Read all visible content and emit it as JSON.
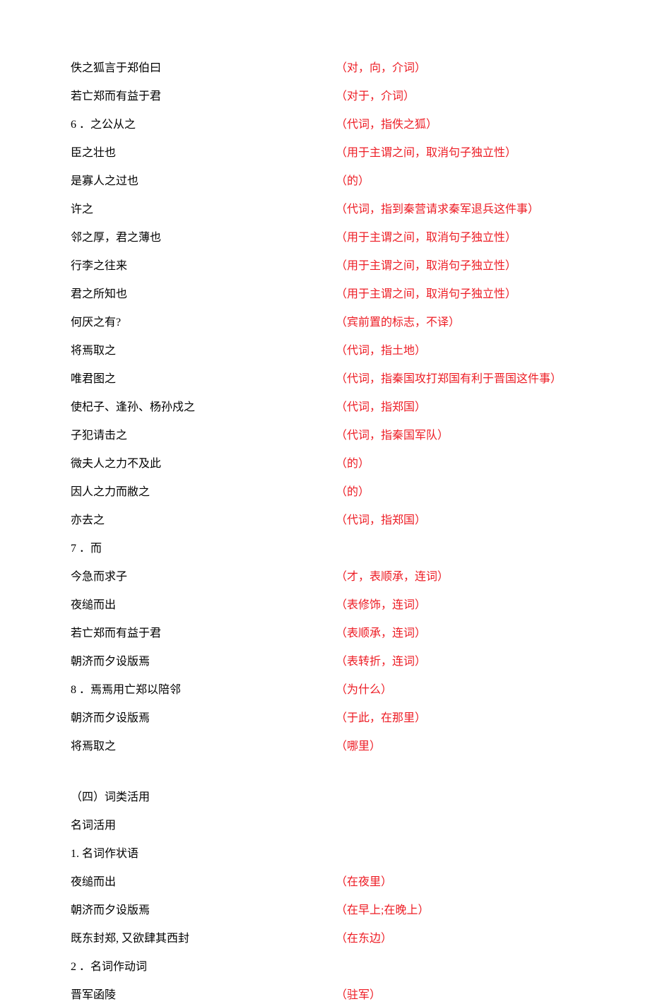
{
  "entries": [
    {
      "left": "佚之狐言于郑伯曰",
      "right": "（对，向，介词）"
    },
    {
      "left": "若亡郑而有益于君",
      "right": "（对于，介词）"
    },
    {
      "left": "6 ．之公从之",
      "right": "（代词，指佚之狐）"
    },
    {
      "left": "臣之壮也",
      "right": "（用于主谓之间，取消句子独立性）"
    },
    {
      "left": "是寡人之过也",
      "right": "（的）"
    },
    {
      "left": "许之",
      "right": "（代词，指到秦营请求秦军退兵这件事）"
    },
    {
      "left": "邻之厚，君之薄也",
      "right": "（用于主谓之间，取消句子独立性）"
    },
    {
      "left": "行李之往来",
      "right": "（用于主谓之间，取消句子独立性）"
    },
    {
      "left": "君之所知也",
      "right": "（用于主谓之间，取消句子独立性）"
    },
    {
      "left": "何厌之有?",
      "right": "（宾前置的标志，不译）"
    },
    {
      "left": "将焉取之",
      "right": "（代词，指土地）"
    },
    {
      "left": "唯君图之",
      "right": "（代词，指秦国攻打郑国有利于晋国这件事）"
    },
    {
      "left": "使杞子、逢孙、杨孙戍之",
      "right": "（代词，指郑国）"
    },
    {
      "left": "子犯请击之",
      "right": "（代词，指秦国军队）"
    },
    {
      "left": "微夫人之力不及此",
      "right": "（的）"
    },
    {
      "left": "因人之力而敝之",
      "right": "（的）"
    },
    {
      "left": "亦去之",
      "right": "（代词，指郑国）"
    },
    {
      "left": "7 ．而",
      "right": ""
    },
    {
      "left": "今急而求子",
      "right": "（才，表顺承，连词）"
    },
    {
      "left": "夜缒而出",
      "right": "（表修饰，连词）"
    },
    {
      "left": "若亡郑而有益于君",
      "right": "（表顺承，连词）"
    },
    {
      "left": "朝济而夕设版焉",
      "right": "（表转折，连词）"
    },
    {
      "left": "8 ．焉焉用亡郑以陪邻",
      "right": "（为什么）"
    },
    {
      "left": "朝济而夕设版焉",
      "right": "（于此，在那里）"
    },
    {
      "left": "将焉取之",
      "right": "（哪里）"
    }
  ],
  "section2": {
    "heading1": "（四）词类活用",
    "heading2": "名词活用",
    "heading3": "1. 名词作状语",
    "items": [
      {
        "left": "夜缒而出",
        "right": "（在夜里）"
      },
      {
        "left": "朝济而夕设版焉",
        "right": "（在早上;在晚上）"
      },
      {
        "left": "既东封郑, 又欲肆其西封",
        "right": "（在东边）"
      }
    ],
    "heading4": "2 ．名词作动词",
    "items2": [
      {
        "left": "晋军函陵",
        "right": "（驻军）"
      }
    ]
  }
}
